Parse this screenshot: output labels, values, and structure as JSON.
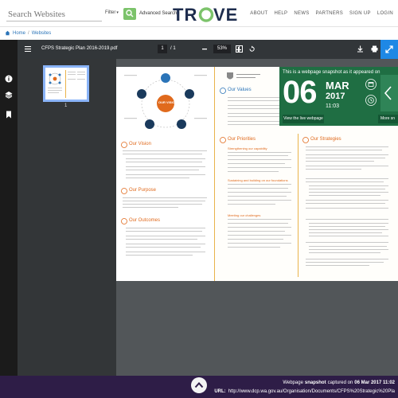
{
  "header": {
    "search_placeholder": "Search Websites",
    "filter_label": "Filter",
    "advanced_search": "Advanced Search",
    "logo_text": "TROVE",
    "nav": [
      "ABOUT",
      "HELP",
      "NEWS",
      "PARTNERS",
      "SIGN UP",
      "LOGIN"
    ]
  },
  "breadcrumb": {
    "home": "Home",
    "sep": "/",
    "current": "Websites"
  },
  "pdf": {
    "title": "CFPS Strategic Plan 2016-2019.pdf",
    "page_current": "1",
    "page_total": "/ 1",
    "zoom": "53%",
    "thumb_page": "1"
  },
  "document": {
    "headings_left": [
      "Our Vision",
      "Our Purpose",
      "Our Outcomes"
    ],
    "headings_mid": [
      "Our Values",
      "Our Priorities"
    ],
    "headings_right": [
      "Our Strategies"
    ],
    "mid_subheads": [
      "Strengthening our capability",
      "Sustaining and building on our foundations",
      "Meeting our challenges"
    ],
    "logo_label": "OUR VISION"
  },
  "snapshot": {
    "header": "This is a webpage snapshot as it appeared on",
    "day": "06",
    "month": "MAR",
    "year": "2017",
    "time": "11:03",
    "live_label": "View the live webpage",
    "more_label": "More sn"
  },
  "footer": {
    "capture_prefix": "Webpage",
    "capture_bold": "snapshot",
    "capture_mid": "captured on",
    "capture_date": "06 Mar 2017 11:02",
    "url_label": "URL:",
    "url": "http://www.dcp.wa.gov.au/Organisation/Documents/CFPS%20Strategic%20Pla"
  },
  "colors": {
    "accent_green": "#7cc36b",
    "footer_purple": "#2e1d47",
    "snapshot_green": "#1f6e43",
    "heading_orange": "#e06a1d"
  }
}
